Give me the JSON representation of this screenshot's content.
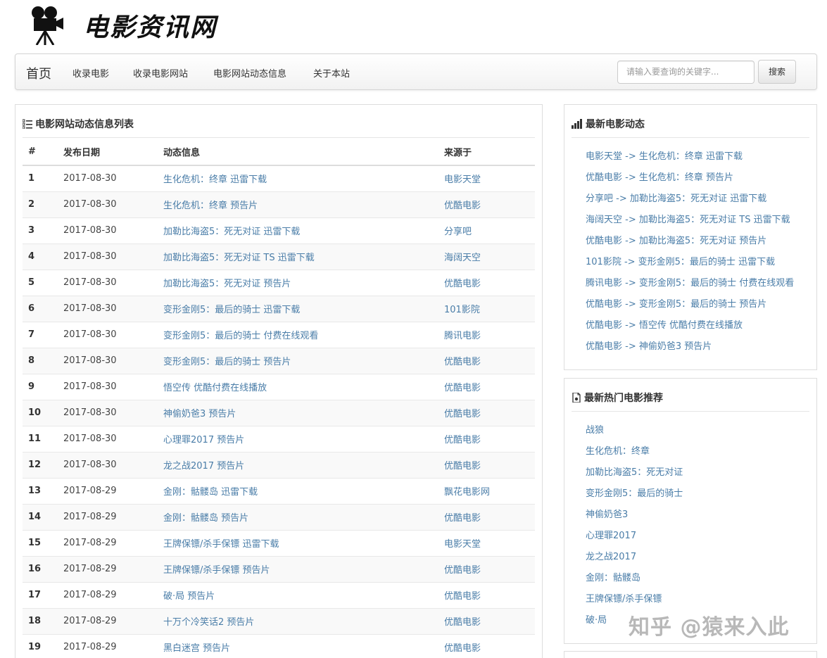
{
  "site": {
    "logo_text": "电影资讯网"
  },
  "nav": {
    "brand": "首页",
    "items": [
      "收录电影",
      "收录电影网站",
      "电影网站动态信息",
      "关于本站"
    ],
    "search_placeholder": "请输入要查询的关键字...",
    "search_button": "搜索"
  },
  "main": {
    "title": "电影网站动态信息列表",
    "columns": [
      "#",
      "发布日期",
      "动态信息",
      "来源于"
    ],
    "rows": [
      {
        "n": "1",
        "date": "2017-08-30",
        "info": "生化危机：终章 迅雷下载",
        "source": "电影天堂"
      },
      {
        "n": "2",
        "date": "2017-08-30",
        "info": "生化危机：终章 预告片",
        "source": "优酷电影"
      },
      {
        "n": "3",
        "date": "2017-08-30",
        "info": "加勒比海盗5：死无对证 迅雷下载",
        "source": "分享吧"
      },
      {
        "n": "4",
        "date": "2017-08-30",
        "info": "加勒比海盗5：死无对证 TS 迅雷下载",
        "source": "海阔天空"
      },
      {
        "n": "5",
        "date": "2017-08-30",
        "info": "加勒比海盗5：死无对证 预告片",
        "source": "优酷电影"
      },
      {
        "n": "6",
        "date": "2017-08-30",
        "info": "变形金刚5：最后的骑士 迅雷下载",
        "source": "101影院"
      },
      {
        "n": "7",
        "date": "2017-08-30",
        "info": "变形金刚5：最后的骑士 付费在线观看",
        "source": "腾讯电影"
      },
      {
        "n": "8",
        "date": "2017-08-30",
        "info": "变形金刚5：最后的骑士 预告片",
        "source": "优酷电影"
      },
      {
        "n": "9",
        "date": "2017-08-30",
        "info": "悟空传 优酷付费在线播放",
        "source": "优酷电影"
      },
      {
        "n": "10",
        "date": "2017-08-30",
        "info": "神偷奶爸3 预告片",
        "source": "优酷电影"
      },
      {
        "n": "11",
        "date": "2017-08-30",
        "info": "心理罪2017 预告片",
        "source": "优酷电影"
      },
      {
        "n": "12",
        "date": "2017-08-30",
        "info": "龙之战2017 预告片",
        "source": "优酷电影"
      },
      {
        "n": "13",
        "date": "2017-08-29",
        "info": "金刚：骷髅岛 迅雷下载",
        "source": "飘花电影网"
      },
      {
        "n": "14",
        "date": "2017-08-29",
        "info": "金刚：骷髅岛 预告片",
        "source": "优酷电影"
      },
      {
        "n": "15",
        "date": "2017-08-29",
        "info": "王牌保镖/杀手保镖 迅雷下载",
        "source": "电影天堂"
      },
      {
        "n": "16",
        "date": "2017-08-29",
        "info": "王牌保镖/杀手保镖 预告片",
        "source": "优酷电影"
      },
      {
        "n": "17",
        "date": "2017-08-29",
        "info": "破·局 预告片",
        "source": "优酷电影"
      },
      {
        "n": "18",
        "date": "2017-08-29",
        "info": "十万个冷笑话2 预告片",
        "source": "优酷电影"
      },
      {
        "n": "19",
        "date": "2017-08-29",
        "info": "黑白迷宫 预告片",
        "source": "优酷电影"
      }
    ]
  },
  "latest": {
    "title": "最新电影动态",
    "items": [
      "电影天堂 -> 生化危机：终章 迅雷下载",
      "优酷电影 -> 生化危机：终章 预告片",
      "分享吧 -> 加勒比海盗5：死无对证 迅雷下载",
      "海阔天空 -> 加勒比海盗5：死无对证 TS 迅雷下载",
      "优酷电影 -> 加勒比海盗5：死无对证 预告片",
      "101影院 -> 变形金刚5：最后的骑士 迅雷下载",
      "腾讯电影 -> 变形金刚5：最后的骑士 付费在线观看",
      "优酷电影 -> 变形金刚5：最后的骑士 预告片",
      "优酷电影 -> 悟空传 优酷付费在线播放",
      "优酷电影 -> 神偷奶爸3 预告片"
    ]
  },
  "hot": {
    "title": "最新热门电影推荐",
    "items": [
      "战狼",
      "生化危机：终章",
      "加勒比海盗5：死无对证",
      "变形金刚5：最后的骑士",
      "神偷奶爸3",
      "心理罪2017",
      "龙之战2017",
      "金刚：骷髅岛",
      "王牌保镖/杀手保镖",
      "破·局"
    ]
  },
  "watermark": "知乎 @猿来入此"
}
